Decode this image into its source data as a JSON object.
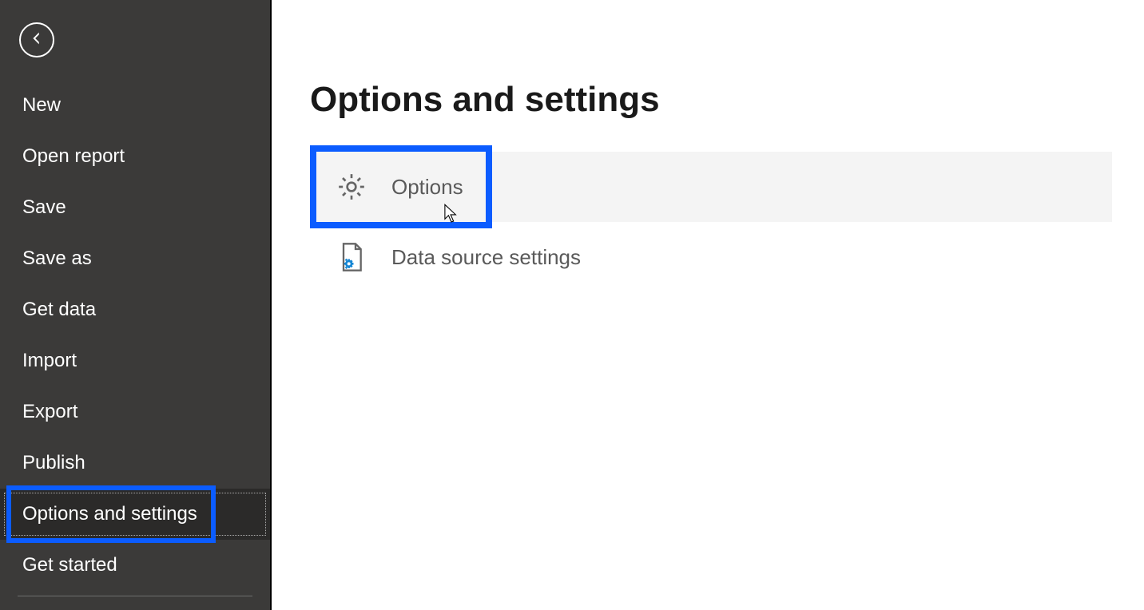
{
  "sidebar": {
    "items": [
      {
        "label": "New"
      },
      {
        "label": "Open report"
      },
      {
        "label": "Save"
      },
      {
        "label": "Save as"
      },
      {
        "label": "Get data"
      },
      {
        "label": "Import"
      },
      {
        "label": "Export"
      },
      {
        "label": "Publish"
      },
      {
        "label": "Options and settings",
        "active": true
      },
      {
        "label": "Get started"
      }
    ]
  },
  "main": {
    "title": "Options and settings",
    "options": [
      {
        "label": "Options",
        "icon": "gear",
        "hovered": true,
        "highlight_width": 228
      },
      {
        "label": "Data source settings",
        "icon": "datasource"
      }
    ]
  },
  "highlight_color": "#0b5cff",
  "sidebar_highlight_width": 262
}
